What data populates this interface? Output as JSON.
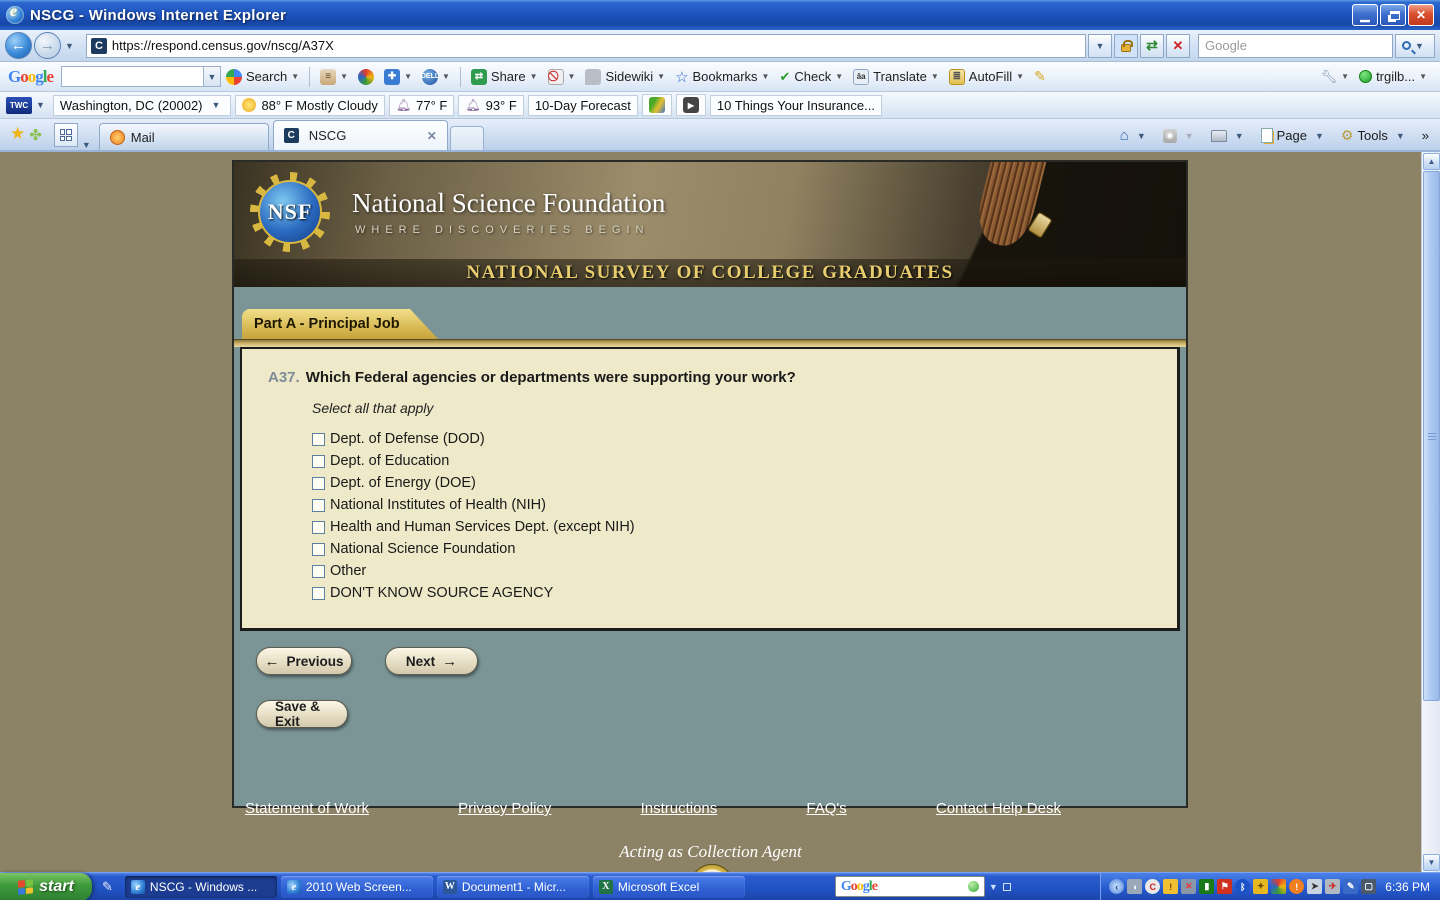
{
  "window": {
    "title": "NSCG - Windows Internet Explorer",
    "url": "https://respond.census.gov/nscg/A37X",
    "search_placeholder": "Google",
    "google_logo_text": "Google"
  },
  "google_toolbar": {
    "search_label": "Search",
    "share_label": "Share",
    "sidewiki_label": "Sidewiki",
    "bookmarks_label": "Bookmarks",
    "check_label": "Check",
    "translate_label": "Translate",
    "autofill_label": "AutoFill",
    "account_label": "trgilb..."
  },
  "twc_toolbar": {
    "logo": "TWC",
    "location": "Washington, DC (20002)",
    "current_conditions": "88° F Mostly Cloudy",
    "temp_low": "77° F",
    "temp_high": "93° F",
    "forecast_label": "10-Day Forecast",
    "headline": "10 Things Your Insurance..."
  },
  "tab_bar": {
    "mail_tab": "Mail",
    "nscg_tab": "NSCG",
    "page_label": "Page",
    "tools_label": "Tools"
  },
  "banner": {
    "logo_text": "NSF",
    "org_name": "National Science Foundation",
    "tagline": "WHERE DISCOVERIES BEGIN",
    "survey_title": "NATIONAL SURVEY OF COLLEGE GRADUATES"
  },
  "survey": {
    "section_tab": "Part A - Principal Job",
    "question_number": "A37.",
    "question_text": "Which Federal agencies or departments were supporting your work?",
    "instruction": "Select all that apply",
    "options": [
      "Dept. of Defense (DOD)",
      "Dept. of Education",
      "Dept. of Energy (DOE)",
      "National Institutes of Health (NIH)",
      "Health and Human Services Dept. (except NIH)",
      "National Science Foundation",
      "Other",
      "DON'T KNOW SOURCE AGENCY"
    ],
    "previous_label": "Previous",
    "next_label": "Next",
    "save_exit_label": "Save & Exit"
  },
  "footer": {
    "links": [
      "Statement of Work",
      "Privacy Policy",
      "Instructions",
      "FAQ's",
      "Contact Help Desk"
    ],
    "agent_note": "Acting as Collection Agent"
  },
  "taskbar": {
    "start_label": "start",
    "tasks": {
      "t0": "NSCG - Windows ...",
      "t1": "2010 Web Screen...",
      "t2": "Document1 - Micr...",
      "t3": "Microsoft Excel"
    },
    "deskbar_logo": "Google",
    "clock": "6:36 PM"
  }
}
